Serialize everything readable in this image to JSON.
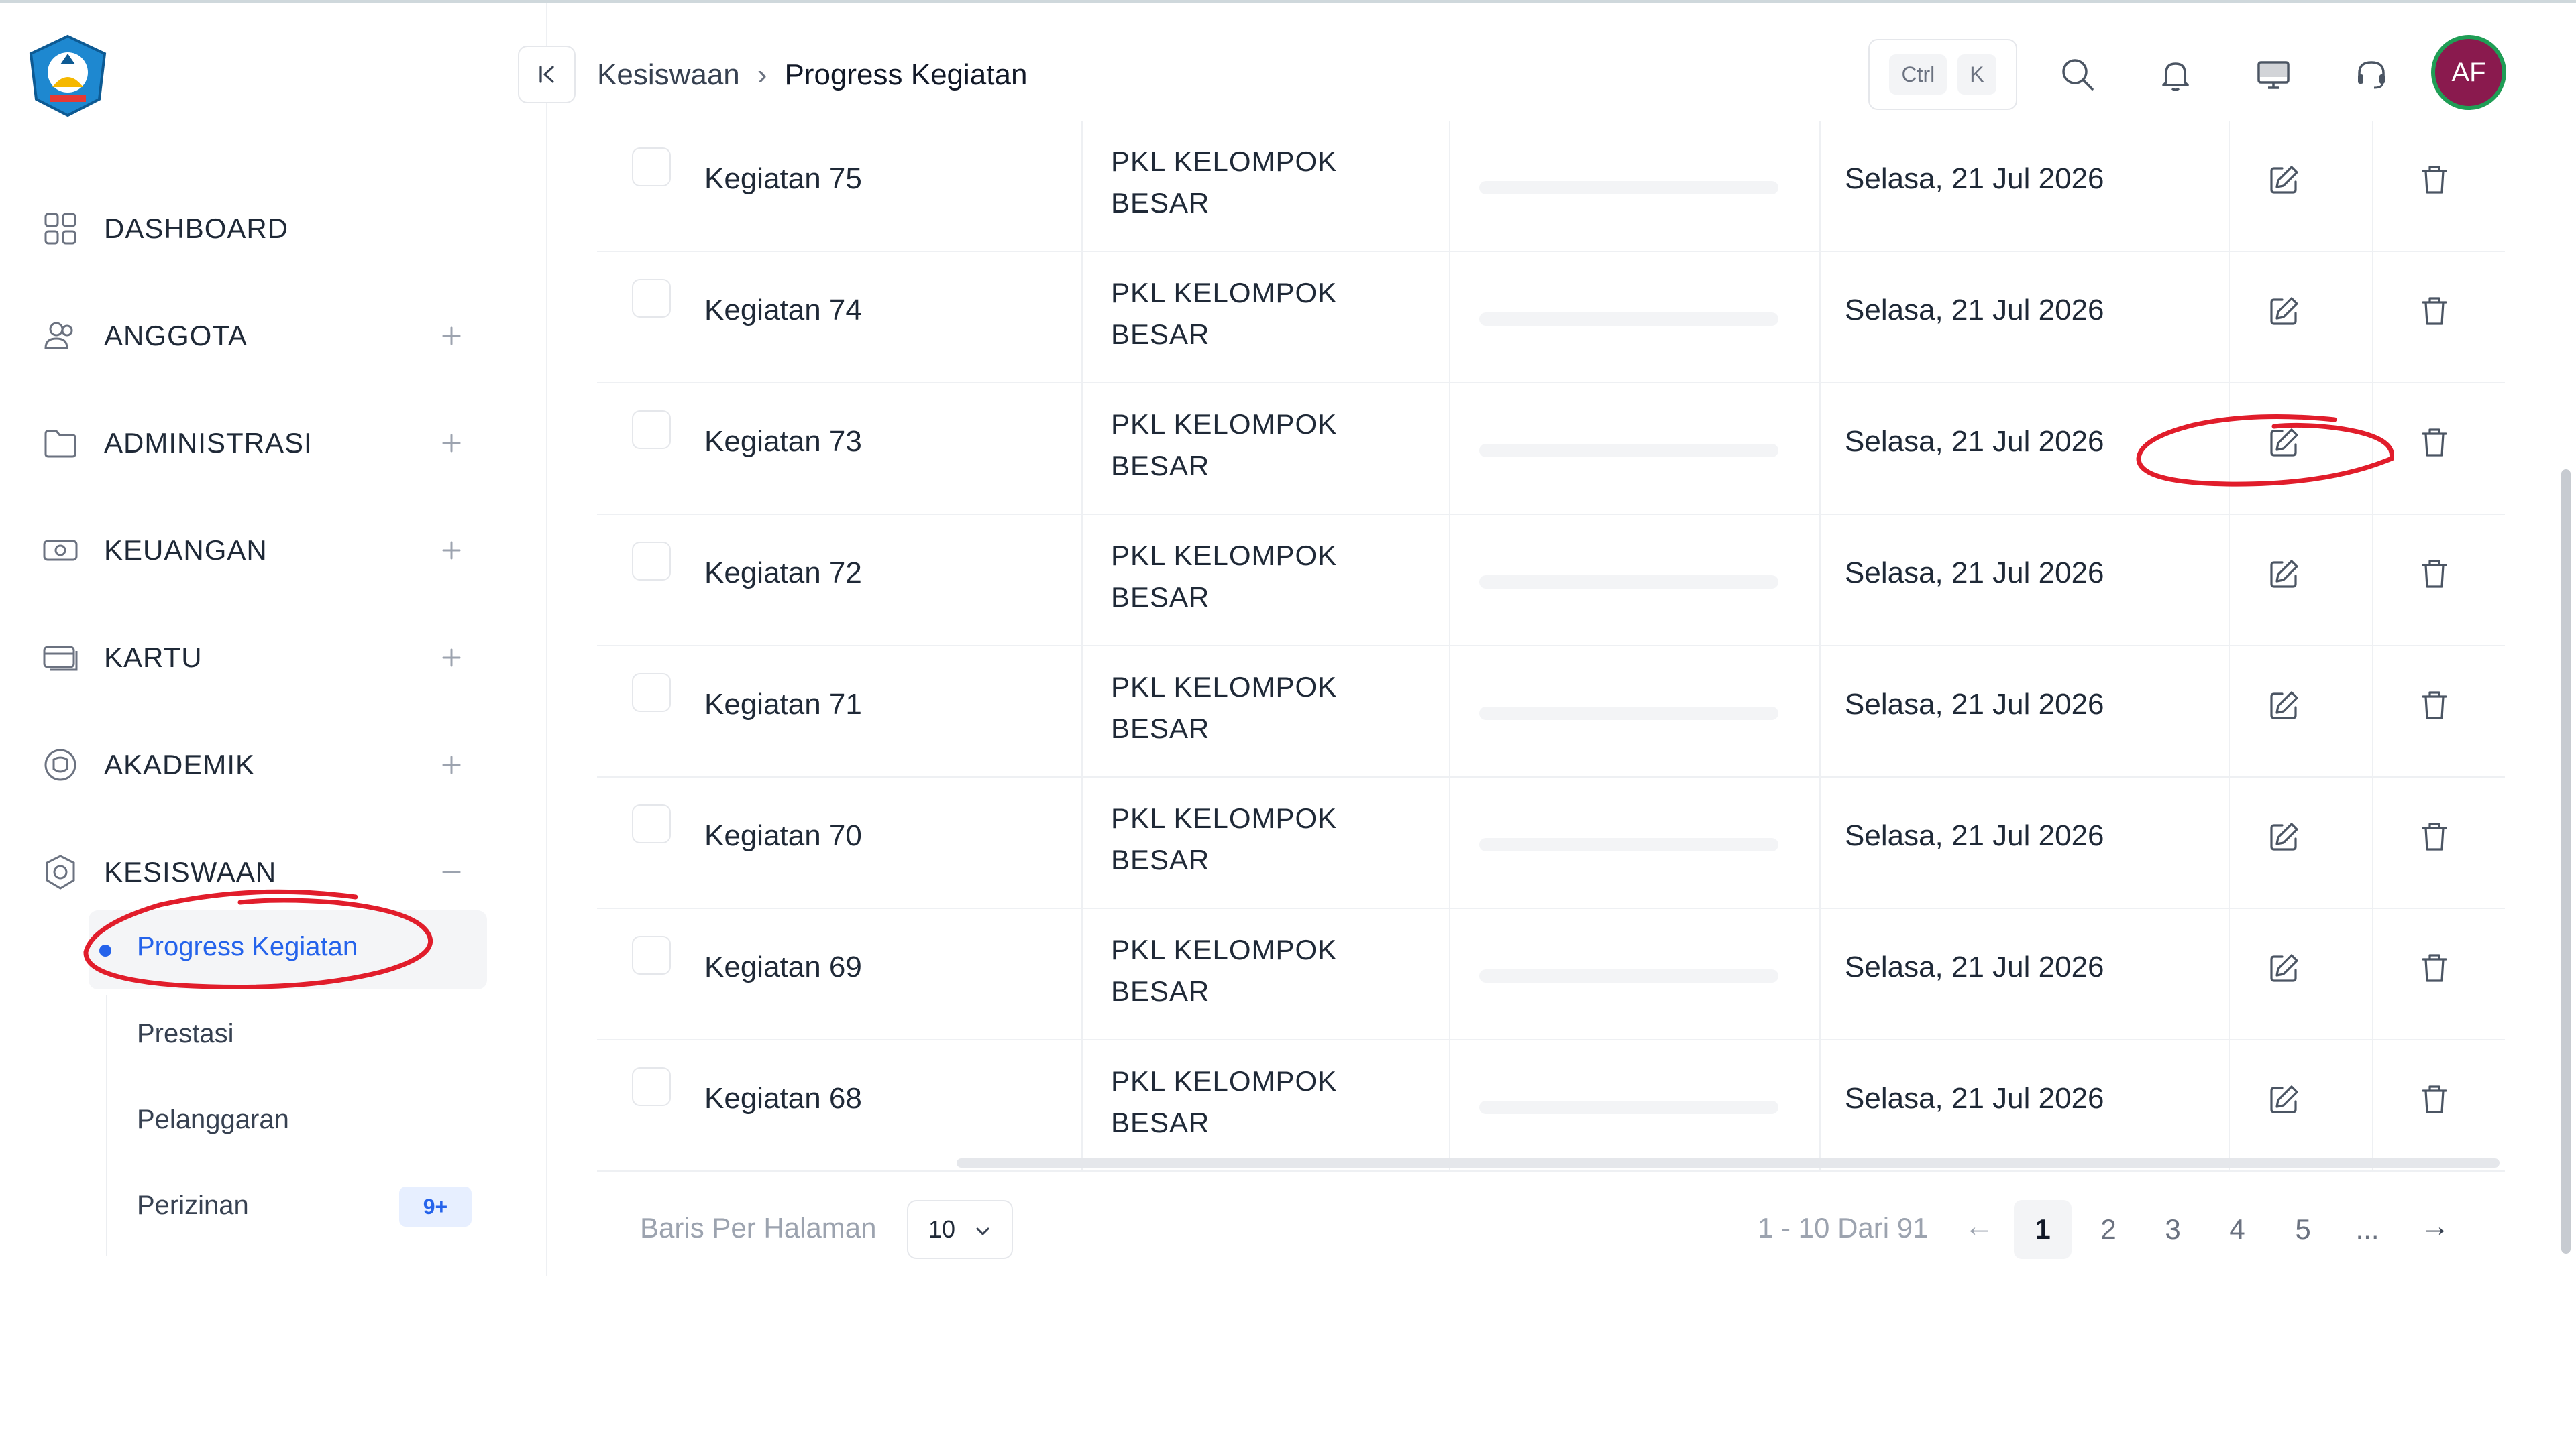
{
  "colors": {
    "accent": "#2563eb",
    "avatar_bg": "#8a1a4e",
    "avatar_ring": "#1f9d55",
    "annotation": "#e11d2b"
  },
  "header": {
    "breadcrumb": [
      "Kesiswaan",
      "Progress Kegiatan"
    ],
    "shortcut_keys": [
      "Ctrl",
      "K"
    ],
    "avatar_initials": "AF",
    "icons": [
      "collapse-sidebar-icon",
      "search-icon",
      "bell-icon",
      "monitor-icon",
      "headset-icon"
    ]
  },
  "sidebar": {
    "items": [
      {
        "label": "DASHBOARD",
        "icon": "grid-icon",
        "expand": ""
      },
      {
        "label": "ANGGOTA",
        "icon": "users-icon",
        "expand": "+"
      },
      {
        "label": "ADMINISTRASI",
        "icon": "folder-icon",
        "expand": "+"
      },
      {
        "label": "KEUANGAN",
        "icon": "money-icon",
        "expand": "+"
      },
      {
        "label": "KARTU",
        "icon": "card-icon",
        "expand": "+"
      },
      {
        "label": "AKADEMIK",
        "icon": "academic-icon",
        "expand": "+"
      },
      {
        "label": "KESISWAAN",
        "icon": "student-icon",
        "expand": "−"
      }
    ],
    "sub_items": [
      {
        "label": "Progress Kegiatan",
        "active": true
      },
      {
        "label": "Prestasi"
      },
      {
        "label": "Pelanggaran"
      },
      {
        "label": "Perizinan",
        "badge": "9+"
      }
    ]
  },
  "table": {
    "rows": [
      {
        "name": "Kegiatan 75",
        "group": "PKL KELOMPOK BESAR",
        "date": "Selasa, 21 Jul 2026",
        "progress": 0
      },
      {
        "name": "Kegiatan 74",
        "group": "PKL KELOMPOK BESAR",
        "date": "Selasa, 21 Jul 2026",
        "progress": 0
      },
      {
        "name": "Kegiatan 73",
        "group": "PKL KELOMPOK BESAR",
        "date": "Selasa, 21 Jul 2026",
        "progress": 0
      },
      {
        "name": "Kegiatan 72",
        "group": "PKL KELOMPOK BESAR",
        "date": "Selasa, 21 Jul 2026",
        "progress": 0
      },
      {
        "name": "Kegiatan 71",
        "group": "PKL KELOMPOK BESAR",
        "date": "Selasa, 21 Jul 2026",
        "progress": 0
      },
      {
        "name": "Kegiatan 70",
        "group": "PKL KELOMPOK BESAR",
        "date": "Selasa, 21 Jul 2026",
        "progress": 0
      },
      {
        "name": "Kegiatan 69",
        "group": "PKL KELOMPOK BESAR",
        "date": "Selasa, 21 Jul 2026",
        "progress": 0
      },
      {
        "name": "Kegiatan 68",
        "group": "PKL KELOMPOK BESAR",
        "date": "Selasa, 21 Jul 2026",
        "progress": 0
      }
    ]
  },
  "footer": {
    "rows_per_page_label": "Baris Per Halaman",
    "rows_per_page_value": "10",
    "range_text": "1 - 10 Dari 91",
    "prev_arrow": "←",
    "next_arrow": "→",
    "pages": [
      "1",
      "2",
      "3",
      "4",
      "5",
      "..."
    ],
    "current_page": "1"
  }
}
